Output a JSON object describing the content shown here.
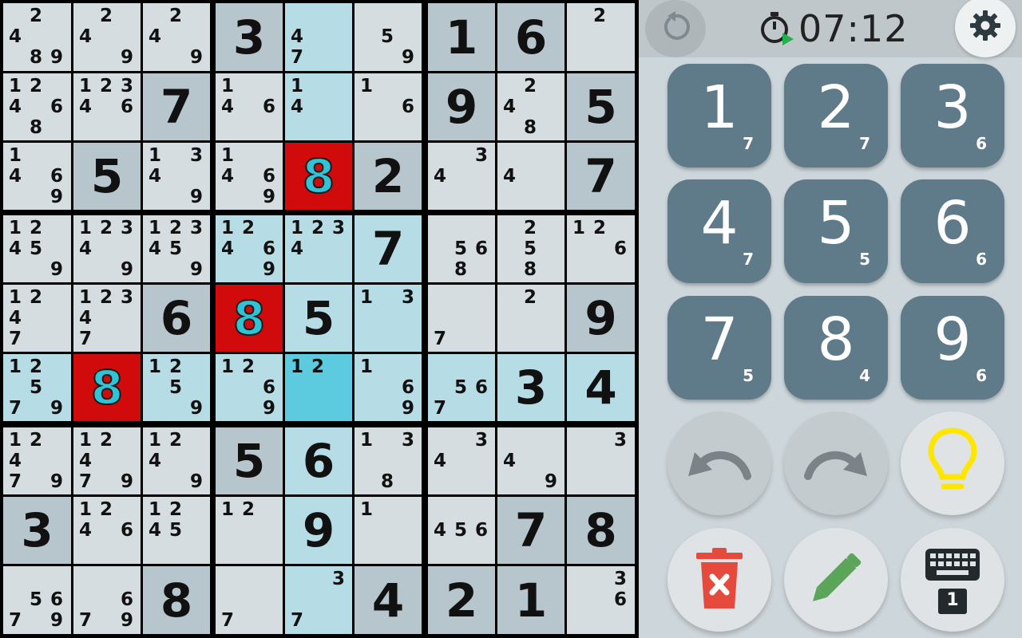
{
  "timer": {
    "time": "07:12"
  },
  "colors": {
    "given_bg": "#b7c5cc",
    "empty_bg": "#d5dde1",
    "highlight_bg": "#b6dde6",
    "selected_bg": "#5ccbdf",
    "conflict_bg": "#d10b0b",
    "conflict_text": "#30c3d6",
    "key_bg": "#5f7a88",
    "hint_yellow": "#ffe600",
    "trash_red": "#e64a3c",
    "pencil_green": "#5aa55a"
  },
  "keypad": [
    {
      "digit": "1",
      "count": "7"
    },
    {
      "digit": "2",
      "count": "7"
    },
    {
      "digit": "3",
      "count": "6"
    },
    {
      "digit": "4",
      "count": "7"
    },
    {
      "digit": "5",
      "count": "5"
    },
    {
      "digit": "6",
      "count": "6"
    },
    {
      "digit": "7",
      "count": "5"
    },
    {
      "digit": "8",
      "count": "4"
    },
    {
      "digit": "9",
      "count": "6"
    }
  ],
  "controls": {
    "undo_icon": "undo-icon",
    "redo_icon": "redo-icon",
    "hint_icon": "lightbulb-icon",
    "erase_icon": "trash-icon",
    "pencil_icon": "pencil-icon",
    "keyboard_icon": "keyboard-icon",
    "keyboard_badge": "1",
    "restart_icon": "restart-icon",
    "settings_icon": "gear-icon",
    "timer_icon": "stopwatch-icon"
  },
  "grid": [
    [
      {
        "n": [
          2,
          4,
          8,
          9
        ]
      },
      {
        "n": [
          2,
          4,
          9
        ]
      },
      {
        "n": [
          2,
          4,
          9
        ]
      },
      {
        "v": "3",
        "given": true
      },
      {
        "n": [
          4,
          7
        ],
        "hl": true
      },
      {
        "n": [
          5,
          9
        ]
      },
      {
        "v": "1",
        "given": true
      },
      {
        "v": "6",
        "given": true
      },
      {
        "n": [
          2
        ]
      }
    ],
    [
      {
        "n": [
          1,
          2,
          4,
          6,
          8
        ]
      },
      {
        "n": [
          1,
          2,
          3,
          4,
          6
        ]
      },
      {
        "v": "7",
        "given": true
      },
      {
        "n": [
          1,
          4,
          6
        ]
      },
      {
        "n": [
          1,
          4
        ],
        "hl": true
      },
      {
        "n": [
          1,
          6
        ]
      },
      {
        "v": "9",
        "given": true
      },
      {
        "n": [
          2,
          4,
          8
        ]
      },
      {
        "v": "5",
        "given": true
      }
    ],
    [
      {
        "n": [
          1,
          4,
          6,
          9
        ]
      },
      {
        "v": "5",
        "given": true
      },
      {
        "n": [
          1,
          3,
          4,
          9
        ]
      },
      {
        "n": [
          1,
          4,
          6,
          9
        ]
      },
      {
        "v": "8",
        "conflict": true
      },
      {
        "v": "2",
        "given": true
      },
      {
        "n": [
          3,
          4
        ]
      },
      {
        "n": [
          4
        ]
      },
      {
        "v": "7",
        "given": true
      }
    ],
    [
      {
        "n": [
          1,
          2,
          4,
          5,
          9
        ]
      },
      {
        "n": [
          1,
          2,
          3,
          4,
          9
        ]
      },
      {
        "n": [
          1,
          2,
          3,
          4,
          5,
          9
        ]
      },
      {
        "n": [
          1,
          2,
          4,
          6,
          9
        ],
        "hl": true
      },
      {
        "n": [
          1,
          2,
          3,
          4
        ],
        "hl": true
      },
      {
        "v": "7",
        "given": true,
        "hl": true
      },
      {
        "n": [
          5,
          6,
          8
        ]
      },
      {
        "n": [
          2,
          5,
          8
        ]
      },
      {
        "n": [
          1,
          2,
          6
        ]
      }
    ],
    [
      {
        "n": [
          1,
          2,
          4,
          7
        ]
      },
      {
        "n": [
          1,
          2,
          3,
          4,
          7
        ]
      },
      {
        "v": "6",
        "given": true
      },
      {
        "v": "8",
        "conflict": true
      },
      {
        "v": "5",
        "given": true,
        "hl": true
      },
      {
        "n": [
          1,
          3
        ],
        "hl": true
      },
      {
        "n": [
          7
        ]
      },
      {
        "n": [
          2
        ]
      },
      {
        "v": "9",
        "given": true
      }
    ],
    [
      {
        "n": [
          1,
          2,
          5,
          7,
          9
        ],
        "hl": true
      },
      {
        "v": "8",
        "conflict": true
      },
      {
        "n": [
          1,
          2,
          5,
          9
        ],
        "hl": true
      },
      {
        "n": [
          1,
          2,
          6,
          9
        ],
        "hl": true
      },
      {
        "n": [
          1,
          2
        ],
        "sel": true
      },
      {
        "n": [
          1,
          6,
          9
        ],
        "hl": true
      },
      {
        "n": [
          5,
          6,
          7
        ],
        "hl": true
      },
      {
        "v": "3",
        "given": true,
        "hl": true
      },
      {
        "v": "4",
        "given": true,
        "hl": true
      }
    ],
    [
      {
        "n": [
          1,
          2,
          4,
          7,
          9
        ]
      },
      {
        "n": [
          1,
          2,
          4,
          7,
          9
        ]
      },
      {
        "n": [
          1,
          2,
          4,
          9
        ]
      },
      {
        "v": "5",
        "given": true
      },
      {
        "v": "6",
        "given": true,
        "hl": true
      },
      {
        "n": [
          1,
          3,
          8
        ]
      },
      {
        "n": [
          3,
          4
        ]
      },
      {
        "n": [
          4,
          9
        ]
      },
      {
        "n": [
          3
        ]
      }
    ],
    [
      {
        "v": "3",
        "given": true
      },
      {
        "n": [
          1,
          2,
          4,
          6
        ]
      },
      {
        "n": [
          1,
          2,
          4,
          5
        ]
      },
      {
        "n": [
          1,
          2
        ]
      },
      {
        "v": "9",
        "given": true,
        "hl": true
      },
      {
        "n": [
          1
        ]
      },
      {
        "n": [
          4,
          5,
          6
        ]
      },
      {
        "v": "7",
        "given": true
      },
      {
        "v": "8",
        "given": true
      }
    ],
    [
      {
        "n": [
          5,
          6,
          7,
          9
        ]
      },
      {
        "n": [
          6,
          7,
          9
        ]
      },
      {
        "v": "8",
        "given": true
      },
      {
        "n": [
          7
        ]
      },
      {
        "n": [
          3,
          7
        ],
        "hl": true
      },
      {
        "v": "4",
        "given": true
      },
      {
        "v": "2",
        "given": true
      },
      {
        "v": "1",
        "given": true
      },
      {
        "n": [
          3,
          6
        ]
      }
    ]
  ]
}
